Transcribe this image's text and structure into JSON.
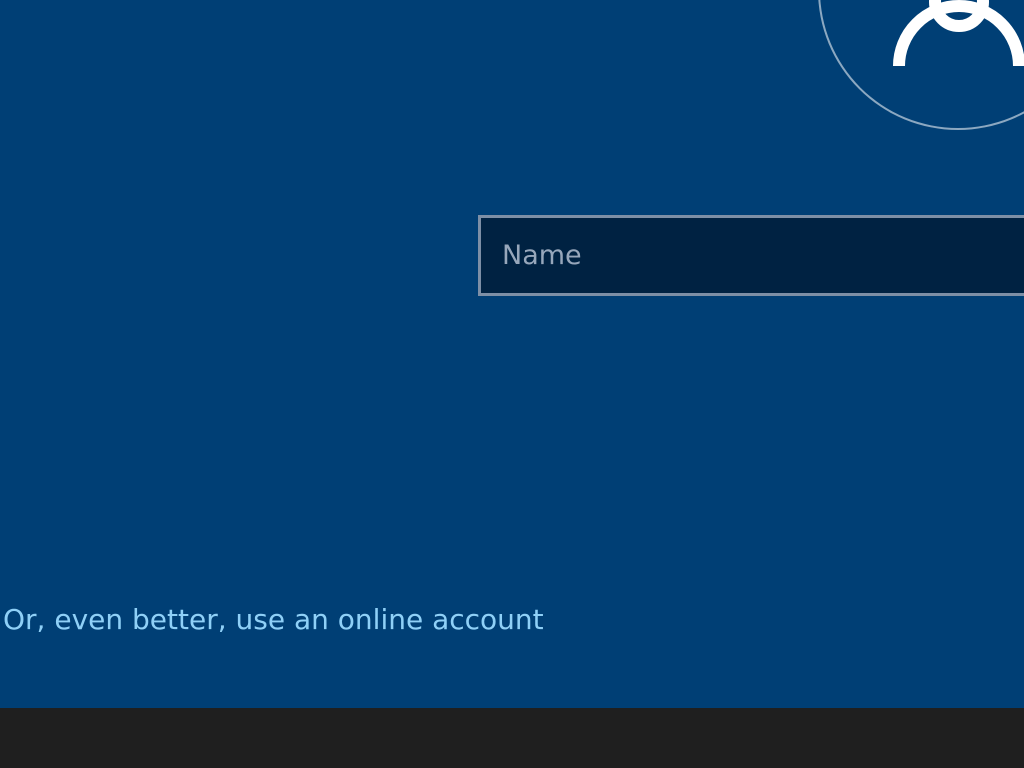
{
  "colors": {
    "background": "#003f75",
    "field_background": "#002242",
    "field_border": "#7d8fa6",
    "link": "#8fd0f7",
    "footer": "#1f1f1f",
    "icon": "#ffffff"
  },
  "account": {
    "avatar_icon": "user-silhouette-icon",
    "name_field": {
      "placeholder": "Name",
      "value": ""
    },
    "online_account_link": "Or, even better, use an online account"
  }
}
